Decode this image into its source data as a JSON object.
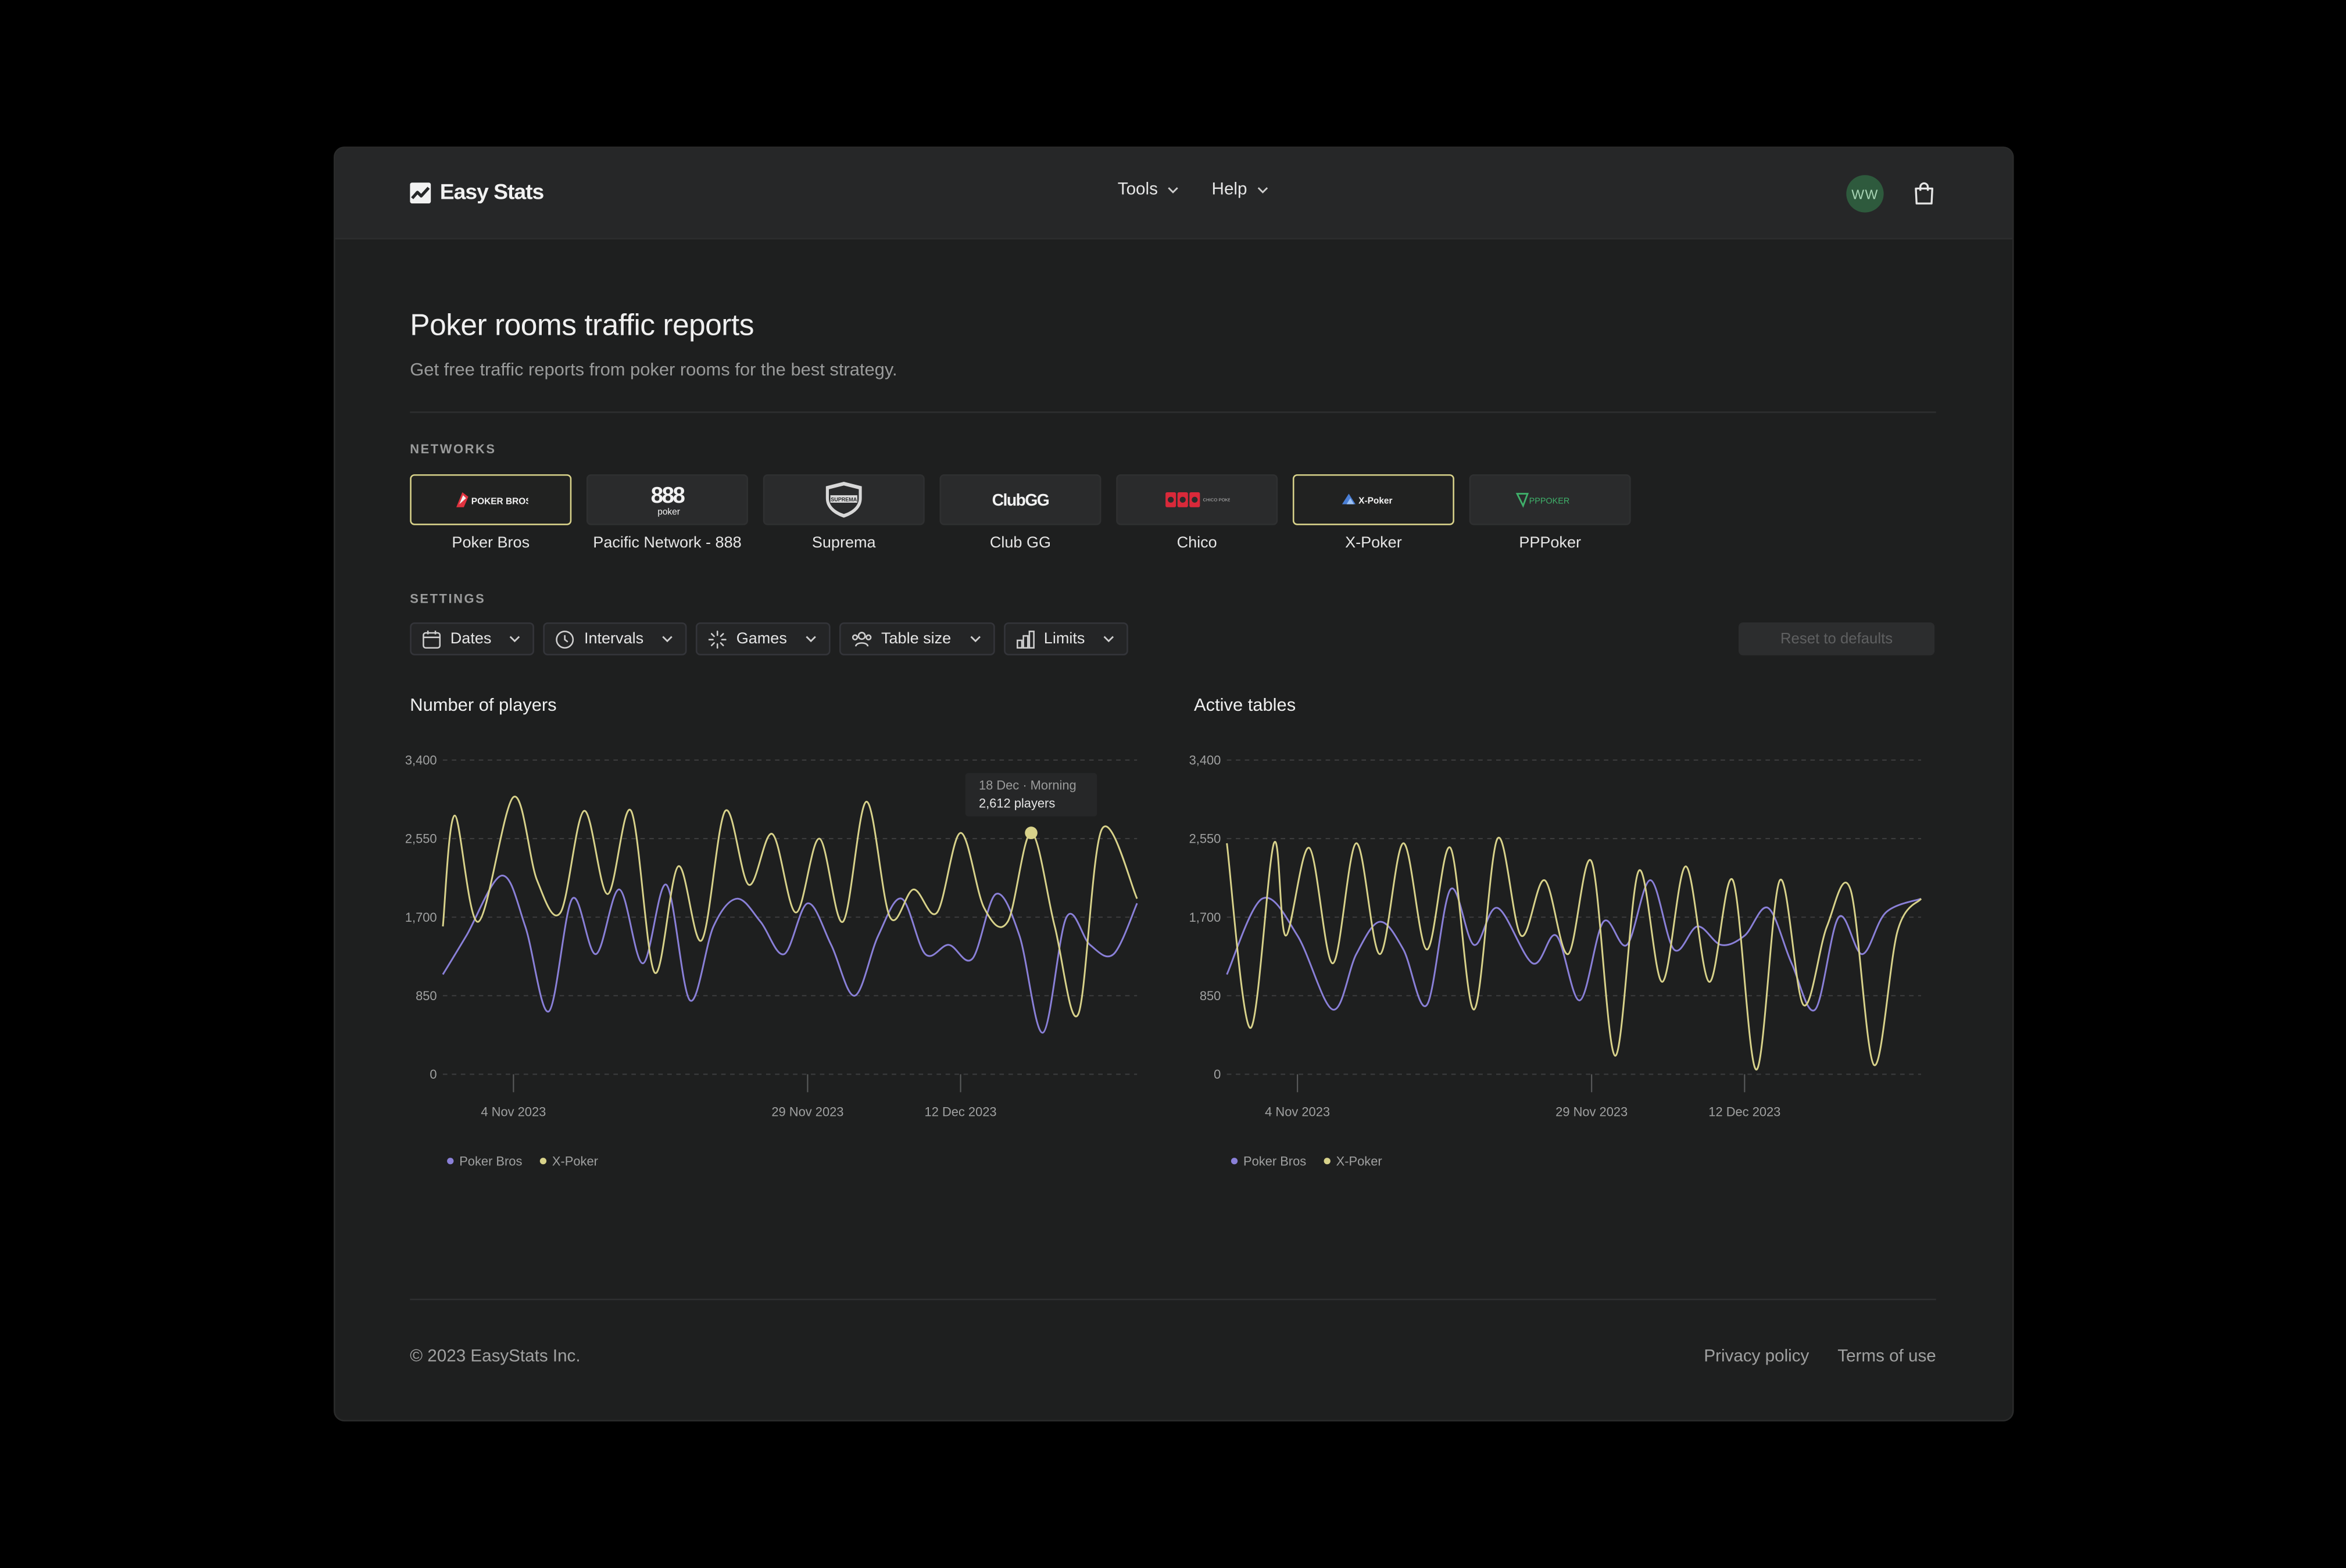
{
  "app": {
    "brand": "Easy Stats",
    "nav": [
      {
        "label": "Tools"
      },
      {
        "label": "Help"
      }
    ],
    "user_initials": "WW"
  },
  "page": {
    "title": "Poker rooms traffic reports",
    "subtitle": "Get free traffic reports from poker rooms for the best strategy."
  },
  "networks": {
    "label": "NETWORKS",
    "items": [
      {
        "name": "Poker Bros",
        "logo_text": "POKER BROS",
        "selected": true
      },
      {
        "name": "Pacific Network - 888",
        "logo_text": "888",
        "logo_sub": "poker",
        "selected": false
      },
      {
        "name": "Suprema",
        "logo_text": "SUPREMA",
        "selected": false
      },
      {
        "name": "Club GG",
        "logo_text": "ClubGG",
        "selected": false
      },
      {
        "name": "Chico",
        "logo_text": "CHICO POKER NETWORK",
        "selected": false
      },
      {
        "name": "X-Poker",
        "logo_text": "X-Poker",
        "selected": true
      },
      {
        "name": "PPPoker",
        "logo_text": "PPPOKER",
        "selected": false
      }
    ]
  },
  "settings": {
    "label": "SETTINGS",
    "filters": [
      {
        "label": "Dates",
        "icon": "calendar-icon"
      },
      {
        "label": "Intervals",
        "icon": "clock-icon"
      },
      {
        "label": "Games",
        "icon": "sparkle-icon"
      },
      {
        "label": "Table size",
        "icon": "users-icon"
      },
      {
        "label": "Limits",
        "icon": "bar-chart-icon"
      }
    ],
    "reset_label": "Reset to defaults"
  },
  "colors": {
    "poker_bros": "#8a80d8",
    "x_poker": "#d8d28a",
    "accent_border": "#d8d28a"
  },
  "chart_data": [
    {
      "type": "line",
      "title": "Number of players",
      "ylim": [
        0,
        3400
      ],
      "yticks": [
        "3,400",
        "2,550",
        "1,700",
        "850",
        "0"
      ],
      "xlim": [
        "2023-10-29",
        "2023-12-27"
      ],
      "xticks": [
        {
          "label": "4 Nov 2023",
          "date": "2023-11-04"
        },
        {
          "label": "29 Nov 2023",
          "date": "2023-11-29"
        },
        {
          "label": "12 Dec 2023",
          "date": "2023-12-12"
        }
      ],
      "series": [
        {
          "name": "Poker Bros",
          "values": [
            {
              "x": "2023-10-29",
              "y": 1080
            },
            {
              "x": "2023-10-31",
              "y": 1500
            },
            {
              "x": "2023-11-03",
              "y": 2150
            },
            {
              "x": "2023-11-05",
              "y": 1600
            },
            {
              "x": "2023-11-07",
              "y": 680
            },
            {
              "x": "2023-11-09",
              "y": 1900
            },
            {
              "x": "2023-11-11",
              "y": 1300
            },
            {
              "x": "2023-11-13",
              "y": 2000
            },
            {
              "x": "2023-11-15",
              "y": 1200
            },
            {
              "x": "2023-11-17",
              "y": 2050
            },
            {
              "x": "2023-11-19",
              "y": 800
            },
            {
              "x": "2023-11-21",
              "y": 1600
            },
            {
              "x": "2023-11-23",
              "y": 1900
            },
            {
              "x": "2023-11-25",
              "y": 1650
            },
            {
              "x": "2023-11-27",
              "y": 1300
            },
            {
              "x": "2023-11-29",
              "y": 1850
            },
            {
              "x": "2023-12-01",
              "y": 1400
            },
            {
              "x": "2023-12-03",
              "y": 850
            },
            {
              "x": "2023-12-05",
              "y": 1500
            },
            {
              "x": "2023-12-07",
              "y": 1900
            },
            {
              "x": "2023-12-09",
              "y": 1300
            },
            {
              "x": "2023-12-11",
              "y": 1400
            },
            {
              "x": "2023-12-13",
              "y": 1250
            },
            {
              "x": "2023-12-15",
              "y": 1950
            },
            {
              "x": "2023-12-17",
              "y": 1500
            },
            {
              "x": "2023-12-19",
              "y": 450
            },
            {
              "x": "2023-12-21",
              "y": 1700
            },
            {
              "x": "2023-12-23",
              "y": 1400
            },
            {
              "x": "2023-12-25",
              "y": 1300
            },
            {
              "x": "2023-12-27",
              "y": 1850
            }
          ]
        },
        {
          "name": "X-Poker",
          "values": [
            {
              "x": "2023-10-29",
              "y": 1600
            },
            {
              "x": "2023-10-30",
              "y": 2800
            },
            {
              "x": "2023-11-01",
              "y": 1650
            },
            {
              "x": "2023-11-04",
              "y": 3000
            },
            {
              "x": "2023-11-06",
              "y": 2100
            },
            {
              "x": "2023-11-08",
              "y": 1750
            },
            {
              "x": "2023-11-10",
              "y": 2850
            },
            {
              "x": "2023-11-12",
              "y": 1950
            },
            {
              "x": "2023-11-14",
              "y": 2850
            },
            {
              "x": "2023-11-16",
              "y": 1100
            },
            {
              "x": "2023-11-18",
              "y": 2250
            },
            {
              "x": "2023-11-20",
              "y": 1450
            },
            {
              "x": "2023-11-22",
              "y": 2850
            },
            {
              "x": "2023-11-24",
              "y": 2050
            },
            {
              "x": "2023-11-26",
              "y": 2600
            },
            {
              "x": "2023-11-28",
              "y": 1750
            },
            {
              "x": "2023-11-30",
              "y": 2550
            },
            {
              "x": "2023-12-02",
              "y": 1650
            },
            {
              "x": "2023-12-04",
              "y": 2950
            },
            {
              "x": "2023-12-06",
              "y": 1700
            },
            {
              "x": "2023-12-08",
              "y": 2000
            },
            {
              "x": "2023-12-10",
              "y": 1750
            },
            {
              "x": "2023-12-12",
              "y": 2612
            },
            {
              "x": "2023-12-14",
              "y": 1800
            },
            {
              "x": "2023-12-16",
              "y": 1650
            },
            {
              "x": "2023-12-18",
              "y": 2612
            },
            {
              "x": "2023-12-20",
              "y": 1600
            },
            {
              "x": "2023-12-22",
              "y": 650
            },
            {
              "x": "2023-12-24",
              "y": 2650
            },
            {
              "x": "2023-12-27",
              "y": 1900
            }
          ]
        }
      ],
      "tooltip": {
        "label": "18 Dec · Morning",
        "value": "2,612 players",
        "series": "X-Poker",
        "x": "2023-12-18",
        "y": 2612
      },
      "legend": [
        "Poker Bros",
        "X-Poker"
      ],
      "grid": true,
      "legend_position": "bottom-left"
    },
    {
      "type": "line",
      "title": "Active tables",
      "ylim": [
        0,
        3400
      ],
      "yticks": [
        "3,400",
        "2,550",
        "1,700",
        "850",
        "0"
      ],
      "xlim": [
        "2023-10-29",
        "2023-12-27"
      ],
      "xticks": [
        {
          "label": "4 Nov 2023",
          "date": "2023-11-04"
        },
        {
          "label": "29 Nov 2023",
          "date": "2023-11-29"
        },
        {
          "label": "12 Dec 2023",
          "date": "2023-12-12"
        }
      ],
      "series": [
        {
          "name": "Poker Bros",
          "values": [
            {
              "x": "2023-10-29",
              "y": 1080
            },
            {
              "x": "2023-11-01",
              "y": 1900
            },
            {
              "x": "2023-11-04",
              "y": 1500
            },
            {
              "x": "2023-11-07",
              "y": 700
            },
            {
              "x": "2023-11-09",
              "y": 1300
            },
            {
              "x": "2023-11-11",
              "y": 1650
            },
            {
              "x": "2023-11-13",
              "y": 1350
            },
            {
              "x": "2023-11-15",
              "y": 750
            },
            {
              "x": "2023-11-17",
              "y": 2000
            },
            {
              "x": "2023-11-19",
              "y": 1400
            },
            {
              "x": "2023-11-21",
              "y": 1800
            },
            {
              "x": "2023-11-24",
              "y": 1200
            },
            {
              "x": "2023-11-26",
              "y": 1500
            },
            {
              "x": "2023-11-28",
              "y": 800
            },
            {
              "x": "2023-11-30",
              "y": 1650
            },
            {
              "x": "2023-12-02",
              "y": 1400
            },
            {
              "x": "2023-12-04",
              "y": 2100
            },
            {
              "x": "2023-12-06",
              "y": 1350
            },
            {
              "x": "2023-12-08",
              "y": 1600
            },
            {
              "x": "2023-12-10",
              "y": 1400
            },
            {
              "x": "2023-12-12",
              "y": 1500
            },
            {
              "x": "2023-12-14",
              "y": 1800
            },
            {
              "x": "2023-12-16",
              "y": 1200
            },
            {
              "x": "2023-12-18",
              "y": 700
            },
            {
              "x": "2023-12-20",
              "y": 1700
            },
            {
              "x": "2023-12-22",
              "y": 1300
            },
            {
              "x": "2023-12-24",
              "y": 1750
            },
            {
              "x": "2023-12-27",
              "y": 1900
            }
          ]
        },
        {
          "name": "X-Poker",
          "values": [
            {
              "x": "2023-10-29",
              "y": 2500
            },
            {
              "x": "2023-10-31",
              "y": 500
            },
            {
              "x": "2023-11-02",
              "y": 2500
            },
            {
              "x": "2023-11-03",
              "y": 1500
            },
            {
              "x": "2023-11-05",
              "y": 2450
            },
            {
              "x": "2023-11-07",
              "y": 1200
            },
            {
              "x": "2023-11-09",
              "y": 2500
            },
            {
              "x": "2023-11-11",
              "y": 1300
            },
            {
              "x": "2023-11-13",
              "y": 2500
            },
            {
              "x": "2023-11-15",
              "y": 1350
            },
            {
              "x": "2023-11-17",
              "y": 2450
            },
            {
              "x": "2023-11-19",
              "y": 700
            },
            {
              "x": "2023-11-21",
              "y": 2550
            },
            {
              "x": "2023-11-23",
              "y": 1500
            },
            {
              "x": "2023-11-25",
              "y": 2100
            },
            {
              "x": "2023-11-27",
              "y": 1300
            },
            {
              "x": "2023-11-29",
              "y": 2300
            },
            {
              "x": "2023-12-01",
              "y": 200
            },
            {
              "x": "2023-12-03",
              "y": 2200
            },
            {
              "x": "2023-12-05",
              "y": 1000
            },
            {
              "x": "2023-12-07",
              "y": 2250
            },
            {
              "x": "2023-12-09",
              "y": 1000
            },
            {
              "x": "2023-12-11",
              "y": 2100
            },
            {
              "x": "2023-12-13",
              "y": 50
            },
            {
              "x": "2023-12-15",
              "y": 2100
            },
            {
              "x": "2023-12-17",
              "y": 750
            },
            {
              "x": "2023-12-19",
              "y": 1600
            },
            {
              "x": "2023-12-21",
              "y": 2000
            },
            {
              "x": "2023-12-23",
              "y": 100
            },
            {
              "x": "2023-12-25",
              "y": 1550
            },
            {
              "x": "2023-12-27",
              "y": 1900
            }
          ]
        }
      ],
      "legend": [
        "Poker Bros",
        "X-Poker"
      ],
      "grid": true,
      "legend_position": "bottom-left"
    }
  ],
  "footer": {
    "copyright": "© 2023 EasyStats Inc.",
    "links": [
      "Privacy policy",
      "Terms of use"
    ]
  }
}
